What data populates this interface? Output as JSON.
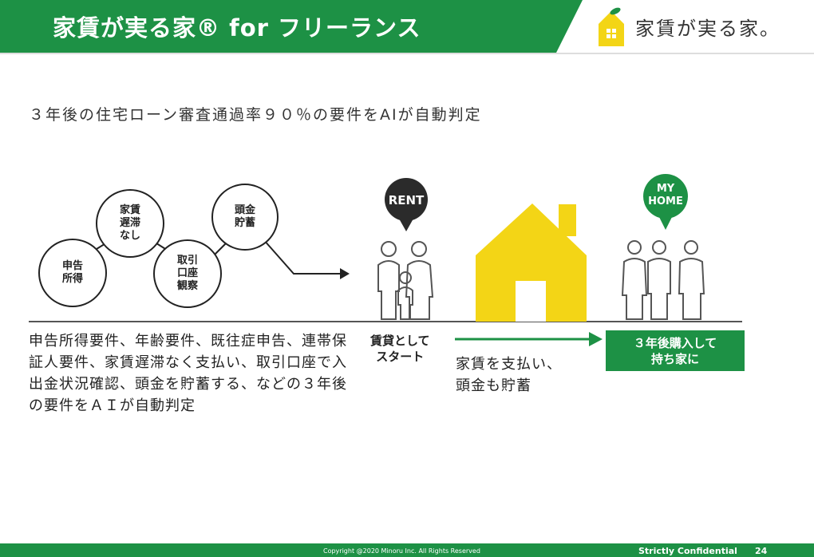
{
  "header": {
    "title": "家賃が実る家® for フリーランス",
    "logo_text": "家賃が実る家。"
  },
  "subtitle": "３年後の住宅ローン審査通過率９０％の要件をAIが自動判定",
  "nodes": {
    "shinkoku": "申告\n所得",
    "yachin": "家賃\n遅滞\nなし",
    "torihiki": "取引\n口座\n観察",
    "atamakin": "頭金\n貯蓄"
  },
  "description": "申告所得要件、年齢要件、既往症申告、連帯保証人要件、家賃遅滞なく支払い、取引口座で入出金状況確認、頭金を貯蓄する、などの３年後の要件をＡＩが自動判定",
  "rent_badge": "RENT",
  "myhome_badge": "MY\nHOME",
  "start_label": "賃貸として\nスタート",
  "pay_label": "家賃を支払い、\n頭金も貯蓄",
  "result": "３年後購入して\n持ち家に",
  "footer": {
    "copyright": "Copyright @2020 Minoru Inc. All Rights Reserved",
    "confidential": "Strictly Confidential",
    "page": "24"
  },
  "colors": {
    "green": "#1d9145",
    "yellow": "#f3d516",
    "dark": "#2b2b2b"
  }
}
